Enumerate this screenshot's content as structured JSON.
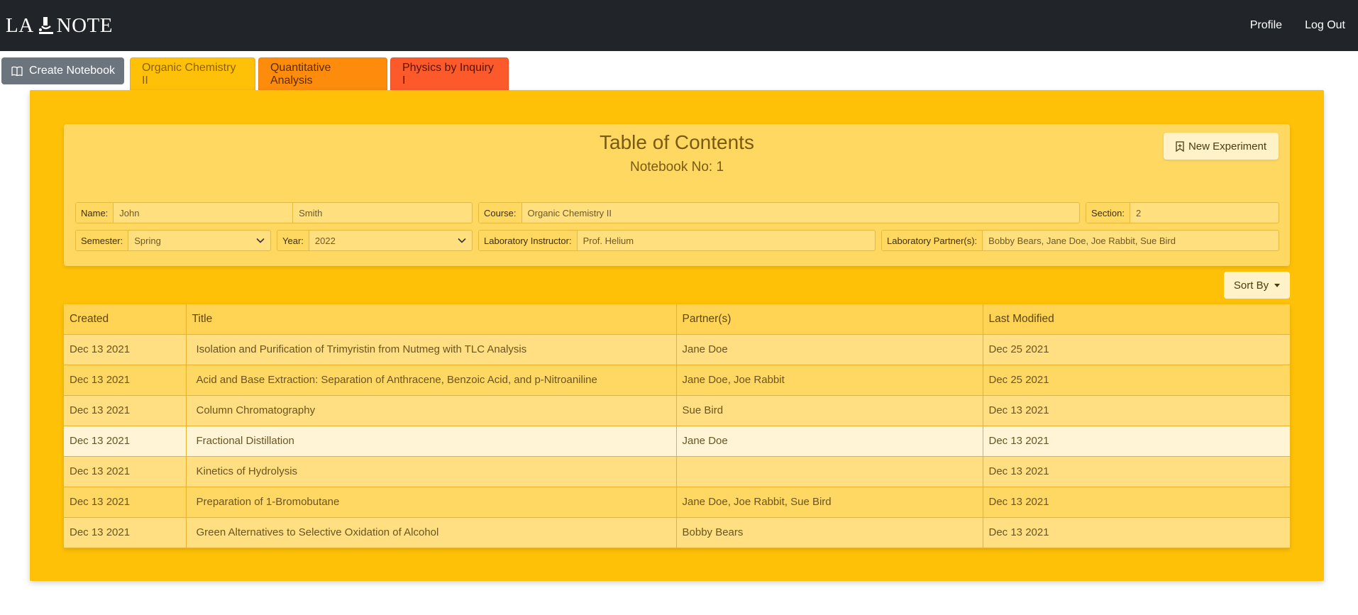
{
  "app": {
    "brand": "LABNOTE",
    "brand_left": "LA",
    "brand_right": "NOTE",
    "nav": {
      "profile": "Profile",
      "logout": "Log Out"
    }
  },
  "tabs": {
    "create_label": "Create Notebook",
    "items": [
      "Organic Chemistry II",
      "Quantitative Analysis",
      "Physics by Inquiry I"
    ]
  },
  "colors": {
    "accent": "#ffc107",
    "tab2": "#fd8c0c",
    "tab3": "#fd5a2b",
    "navbar": "#212529",
    "create_btn": "#6c757d"
  },
  "toc": {
    "title": "Table of Contents",
    "notebook_no": "Notebook No: 1",
    "new_experiment": "New Experiment"
  },
  "form": {
    "name_label": "Name:",
    "first_name": "John",
    "last_name": "Smith",
    "course_label": "Course:",
    "course": "Organic Chemistry II",
    "section_label": "Section:",
    "section": "2",
    "semester_label": "Semester:",
    "semester": "Spring",
    "year_label": "Year:",
    "year": "2022",
    "instructor_label": "Laboratory Instructor:",
    "instructor": "Prof. Helium",
    "partners_label": "Laboratory Partner(s):",
    "partners": "Bobby Bears, Jane Doe, Joe Rabbit, Sue Bird"
  },
  "sort": {
    "label": "Sort By"
  },
  "table": {
    "headers": [
      "Created",
      "Title",
      "Partner(s)",
      "Last Modified"
    ],
    "rows": [
      {
        "created": "Dec 13 2021",
        "title": "Isolation and Purification of Trimyristin from Nutmeg with TLC Analysis",
        "partners": "Jane Doe",
        "modified": "Dec 25 2021"
      },
      {
        "created": "Dec 13 2021",
        "title": "Acid and Base Extraction: Separation of Anthracene, Benzoic Acid, and p-Nitroaniline",
        "partners": "Jane Doe, Joe Rabbit",
        "modified": "Dec 25 2021"
      },
      {
        "created": "Dec 13 2021",
        "title": "Column Chromatography",
        "partners": "Sue Bird",
        "modified": "Dec 13 2021"
      },
      {
        "created": "Dec 13 2021",
        "title": "Fractional Distillation",
        "partners": "Jane Doe",
        "modified": "Dec 13 2021"
      },
      {
        "created": "Dec 13 2021",
        "title": "Kinetics of Hydrolysis",
        "partners": "",
        "modified": "Dec 13 2021"
      },
      {
        "created": "Dec 13 2021",
        "title": "Preparation of 1-Bromobutane",
        "partners": "Jane Doe, Joe Rabbit, Sue Bird",
        "modified": "Dec 13 2021"
      },
      {
        "created": "Dec 13 2021",
        "title": "Green Alternatives to Selective Oxidation of Alcohol",
        "partners": "Bobby Bears",
        "modified": "Dec 13 2021"
      }
    ]
  }
}
